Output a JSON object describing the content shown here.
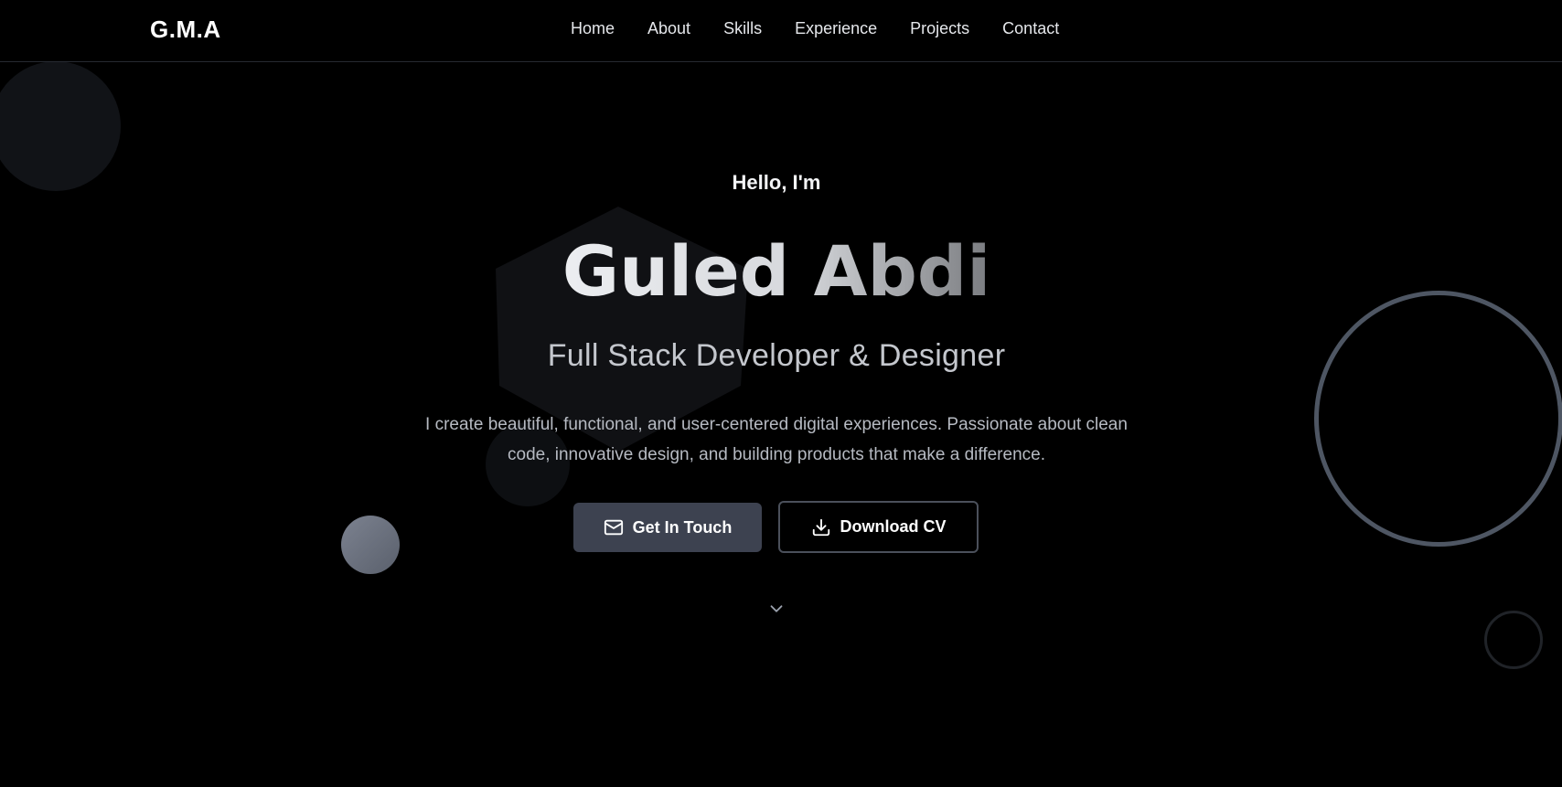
{
  "nav": {
    "logo": "G.M.A",
    "links": [
      {
        "label": "Home"
      },
      {
        "label": "About"
      },
      {
        "label": "Skills"
      },
      {
        "label": "Experience"
      },
      {
        "label": "Projects"
      },
      {
        "label": "Contact"
      }
    ]
  },
  "hero": {
    "greeting": "Hello, I'm",
    "name": "Guled Abdi",
    "role": "Full Stack Developer & Designer",
    "bio": "I create beautiful, functional, and user-centered digital experiences. Passionate about clean code, innovative design, and building products that make a difference.",
    "primary_button": {
      "label": "Get In Touch",
      "icon": "mail-icon"
    },
    "secondary_button": {
      "label": "Download CV",
      "icon": "download-icon"
    },
    "scroll_icon": "chevron-down-icon"
  },
  "colors": {
    "background": "#000000",
    "primary_button": "#3d4250",
    "ring": "#4e5663",
    "text_muted": "#b6bac2"
  }
}
